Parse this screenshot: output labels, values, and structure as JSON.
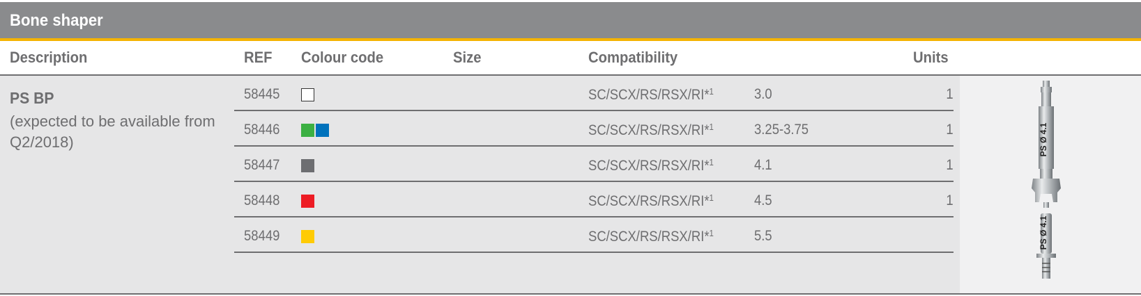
{
  "title": "Bone shaper",
  "colors": {
    "title_bar": "#8a8b8d",
    "accent_line": "#f5b300",
    "text": "#6e6e70",
    "row_bg": "#e6e6e7"
  },
  "headers": {
    "description": "Description",
    "ref": "REF",
    "colour_code": "Colour code",
    "size": "Size",
    "compatibility": "Compatibility",
    "units": "Units"
  },
  "product": {
    "name": "PS BP",
    "note": "(expected to be available from Q2/2018)",
    "image_labels": [
      "PS Ø 4.1",
      "PS Ø 4.1"
    ]
  },
  "rows": [
    {
      "ref": "58445",
      "colours": [
        "#ffffff"
      ],
      "compat": "SC/SCX/RS/RSX/RI*",
      "compat_sup": "1",
      "size": "3.0",
      "units": "1"
    },
    {
      "ref": "58446",
      "colours": [
        "#3cb043",
        "#0072bc"
      ],
      "compat": "SC/SCX/RS/RSX/RI*",
      "compat_sup": "1",
      "size": "3.25-3.75",
      "units": "1"
    },
    {
      "ref": "58447",
      "colours": [
        "#6d6e71"
      ],
      "compat": "SC/SCX/RS/RSX/RI*",
      "compat_sup": "1",
      "size": "4.1",
      "units": "1"
    },
    {
      "ref": "58448",
      "colours": [
        "#ed1c24"
      ],
      "compat": "SC/SCX/RS/RSX/RI*",
      "compat_sup": "1",
      "size": "4.5",
      "units": "1"
    },
    {
      "ref": "58449",
      "colours": [
        "#ffcb05"
      ],
      "compat": "SC/SCX/RS/RSX/RI*",
      "compat_sup": "1",
      "size": "5.5",
      "units": ""
    }
  ]
}
